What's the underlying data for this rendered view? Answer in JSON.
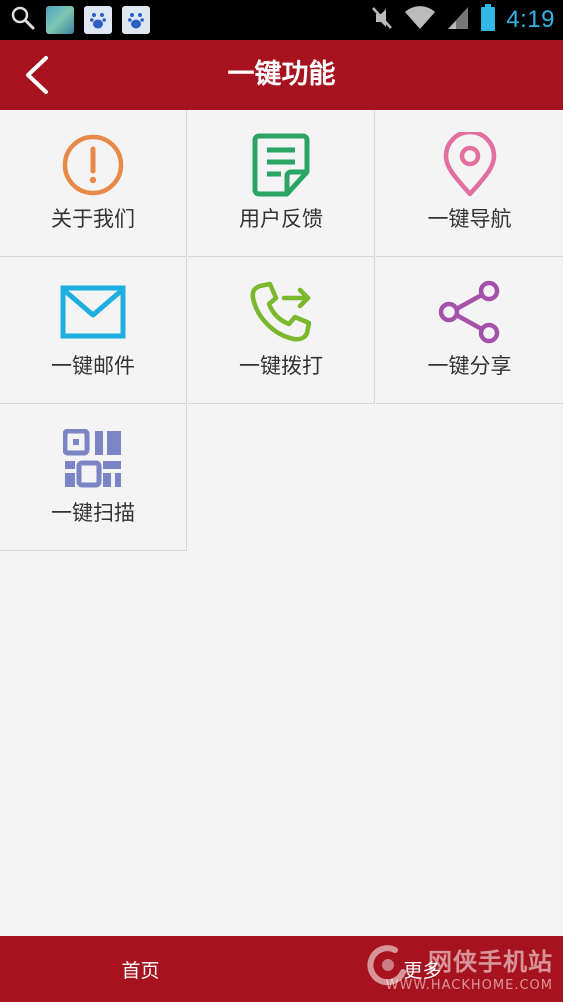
{
  "status_bar": {
    "time": "4:19",
    "icons": [
      "search-icon",
      "photo-thumbnail",
      "baidu-icon",
      "baidu-icon",
      "mute-icon",
      "wifi-icon",
      "signal-icon",
      "battery-icon"
    ]
  },
  "header": {
    "title": "一键功能",
    "back_icon": "chevron-left-icon"
  },
  "grid": {
    "items": [
      {
        "label": "关于我们",
        "icon": "info-circle-icon",
        "color": "#e8894a"
      },
      {
        "label": "用户反馈",
        "icon": "feedback-note-icon",
        "color": "#2aa566"
      },
      {
        "label": "一键导航",
        "icon": "map-pin-icon",
        "color": "#e36ea0"
      },
      {
        "label": "一键邮件",
        "icon": "envelope-icon",
        "color": "#1eaee0"
      },
      {
        "label": "一键拨打",
        "icon": "phone-forward-icon",
        "color": "#7cb82e"
      },
      {
        "label": "一键分享",
        "icon": "share-icon",
        "color": "#a451a9"
      },
      {
        "label": "一键扫描",
        "icon": "qr-code-icon",
        "color": "#7b84c4"
      }
    ]
  },
  "tab_bar": {
    "tabs": [
      {
        "label": "首页"
      },
      {
        "label": "更多"
      }
    ],
    "watermark": {
      "text": "网侠手机站",
      "url": "WWW.HACKHOME.COM"
    }
  },
  "colors": {
    "primary": "#a6131e",
    "background": "#f4f4f4",
    "divider": "#d7d7d7",
    "clock": "#33b5e5"
  }
}
